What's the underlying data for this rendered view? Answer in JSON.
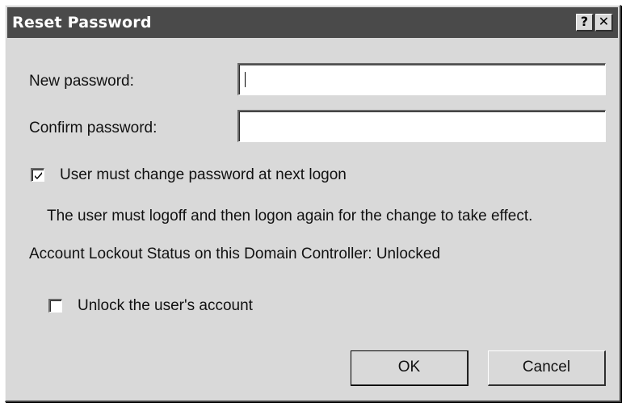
{
  "window": {
    "title": "Reset Password",
    "help_button": "?",
    "close_button": "✕"
  },
  "form": {
    "new_password_label": "New password:",
    "new_password_value": "",
    "confirm_password_label": "Confirm password:",
    "confirm_password_value": ""
  },
  "options": {
    "must_change_label": "User must change password at next logon",
    "must_change_checked": true,
    "note": "The user must logoff and then logon again for the change to take effect.",
    "lockout_status": "Account Lockout Status on this Domain Controller: Unlocked",
    "unlock_label": "Unlock the user's account",
    "unlock_checked": false
  },
  "buttons": {
    "ok": "OK",
    "cancel": "Cancel"
  }
}
